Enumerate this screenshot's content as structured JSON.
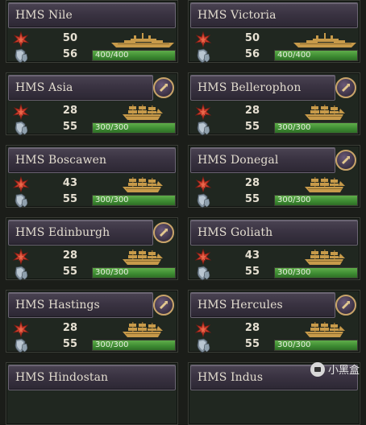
{
  "fleet": {
    "ships": [
      {
        "name": "HMS Nile",
        "attack": "50",
        "defense": "56",
        "hp": "400/400",
        "hp_fraction": 1.0,
        "ship_class": "ironclad",
        "has_upgrade": false
      },
      {
        "name": "HMS Victoria",
        "attack": "50",
        "defense": "56",
        "hp": "400/400",
        "hp_fraction": 1.0,
        "ship_class": "ironclad",
        "has_upgrade": false
      },
      {
        "name": "HMS Asia",
        "attack": "28",
        "defense": "55",
        "hp": "300/300",
        "hp_fraction": 1.0,
        "ship_class": "sail",
        "has_upgrade": true
      },
      {
        "name": "HMS Bellerophon",
        "attack": "28",
        "defense": "55",
        "hp": "300/300",
        "hp_fraction": 1.0,
        "ship_class": "sail",
        "has_upgrade": true
      },
      {
        "name": "HMS Boscawen",
        "attack": "43",
        "defense": "55",
        "hp": "300/300",
        "hp_fraction": 1.0,
        "ship_class": "sail",
        "has_upgrade": false
      },
      {
        "name": "HMS Donegal",
        "attack": "28",
        "defense": "55",
        "hp": "300/300",
        "hp_fraction": 1.0,
        "ship_class": "sail",
        "has_upgrade": true
      },
      {
        "name": "HMS Edinburgh",
        "attack": "28",
        "defense": "55",
        "hp": "300/300",
        "hp_fraction": 1.0,
        "ship_class": "sail",
        "has_upgrade": true
      },
      {
        "name": "HMS Goliath",
        "attack": "43",
        "defense": "55",
        "hp": "300/300",
        "hp_fraction": 1.0,
        "ship_class": "sail",
        "has_upgrade": false
      },
      {
        "name": "HMS Hastings",
        "attack": "28",
        "defense": "55",
        "hp": "300/300",
        "hp_fraction": 1.0,
        "ship_class": "sail",
        "has_upgrade": true
      },
      {
        "name": "HMS Hercules",
        "attack": "28",
        "defense": "55",
        "hp": "300/300",
        "hp_fraction": 1.0,
        "ship_class": "sail",
        "has_upgrade": true
      },
      {
        "name": "HMS Hindostan",
        "attack": "",
        "defense": "",
        "hp": "",
        "hp_fraction": 1.0,
        "ship_class": "sail",
        "has_upgrade": false
      },
      {
        "name": "HMS Indus",
        "attack": "",
        "defense": "",
        "hp": "",
        "hp_fraction": 1.0,
        "ship_class": "sail",
        "has_upgrade": false
      }
    ]
  },
  "icons": {
    "attack": "attack-icon",
    "defense": "defense-shield-icon",
    "upgrade": "upgrade-icon",
    "ironclad": "ironclad-ship-icon",
    "sail": "sailing-ship-icon"
  },
  "colors": {
    "card_bg": "#202720",
    "name_bar": "#3a3342",
    "hp_green": "#3c8a31",
    "attack_red": "#c53a2a",
    "defense_steel": "#a8b6c3",
    "ship_gold": "#c79a4a",
    "upgrade_ring": "#c9a46a"
  },
  "watermark": {
    "text": "小黑盒"
  }
}
